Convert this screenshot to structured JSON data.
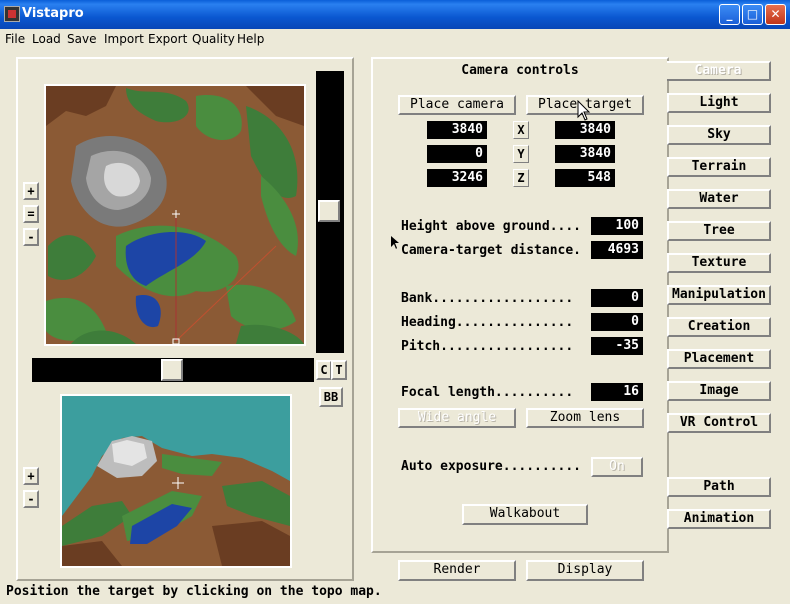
{
  "window": {
    "title": "Vistapro",
    "minimize": "_",
    "maximize": "□",
    "close": "✕"
  },
  "menu": [
    "File",
    "Load",
    "Save",
    "Import",
    "Export",
    "Quality",
    "Help"
  ],
  "map_controls": {
    "zoom_in": "+",
    "reset": "=",
    "zoom_out": "-",
    "c": "C",
    "t": "T",
    "bb": "BB",
    "view_zoom_in": "+",
    "view_zoom_out": "-"
  },
  "camera": {
    "title": "Camera controls",
    "place_camera": "Place camera",
    "place_target": "Place target",
    "camera_x": "3840",
    "camera_y": "0",
    "camera_z": "3246",
    "target_x": "3840",
    "target_y": "3840",
    "target_z": "548",
    "axis_x": "X",
    "axis_y": "Y",
    "axis_z": "Z",
    "height_label": "Height above ground....",
    "height_value": "100",
    "distance_label": "Camera-target distance.",
    "distance_value": "4693",
    "bank_label": "Bank..................",
    "bank_value": "0",
    "heading_label": "Heading...............",
    "heading_value": "0",
    "pitch_label": "Pitch.................",
    "pitch_value": "-35",
    "focal_label": "Focal length..........",
    "focal_value": "16",
    "wide_angle": "Wide angle",
    "zoom_lens": "Zoom lens",
    "auto_exposure_label": "Auto exposure..........",
    "auto_exposure_value": "On",
    "walkabout": "Walkabout"
  },
  "tabs": [
    "Camera",
    "Light",
    "Sky",
    "Terrain",
    "Water",
    "Tree",
    "Texture",
    "Manipulation",
    "Creation",
    "Placement",
    "Image",
    "VR Control",
    "Path",
    "Animation"
  ],
  "active_tab": "Camera",
  "bottom": {
    "render": "Render",
    "display": "Display"
  },
  "status": "Position the target by clicking on the topo map."
}
